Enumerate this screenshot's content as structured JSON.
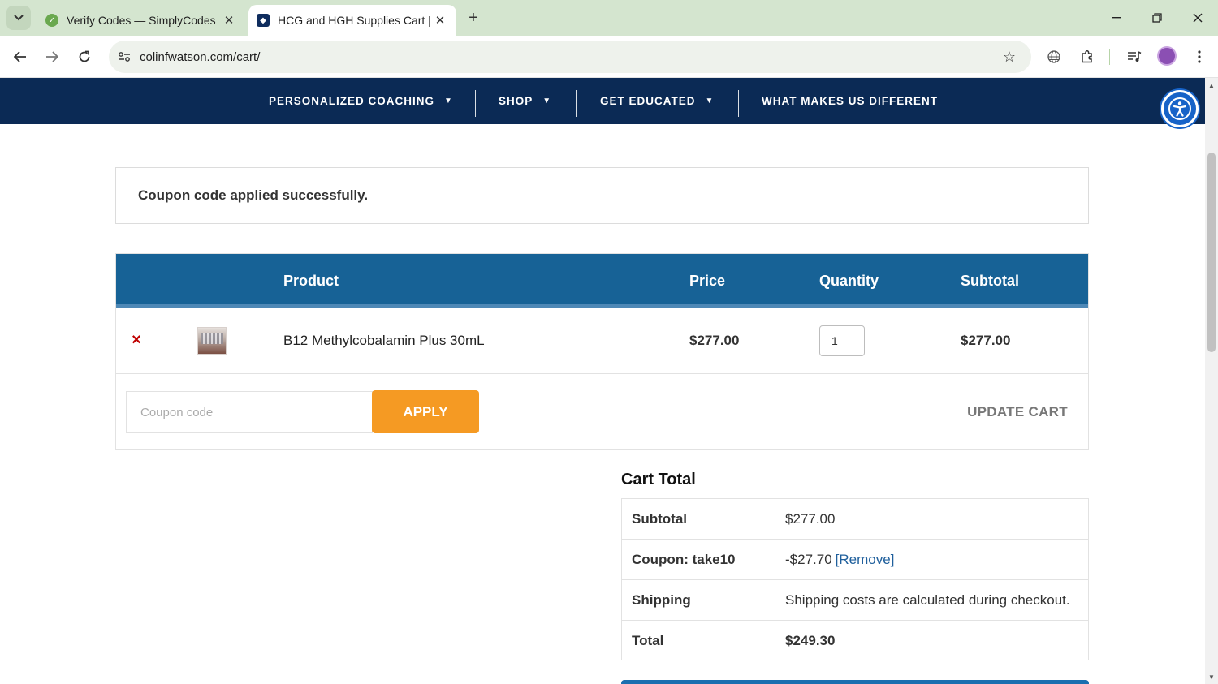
{
  "browser": {
    "tabs": [
      {
        "title": "Verify Codes — SimplyCodes",
        "active": false
      },
      {
        "title": "HCG and HGH Supplies Cart | C",
        "active": true
      }
    ],
    "new_tab_glyph": "+",
    "url": "colinfwatson.com/cart/"
  },
  "nav": {
    "items": [
      {
        "label": "PERSONALIZED COACHING",
        "has_dropdown": true
      },
      {
        "label": "SHOP",
        "has_dropdown": true
      },
      {
        "label": "GET EDUCATED",
        "has_dropdown": true
      },
      {
        "label": "WHAT MAKES US DIFFERENT",
        "has_dropdown": false
      }
    ]
  },
  "notice": {
    "text": "Coupon code applied successfully."
  },
  "cart": {
    "headers": {
      "product": "Product",
      "price": "Price",
      "quantity": "Quantity",
      "subtotal": "Subtotal"
    },
    "items": [
      {
        "remove_glyph": "×",
        "name": "B12 Methylcobalamin Plus 30mL",
        "price": "$277.00",
        "quantity": "1",
        "subtotal": "$277.00"
      }
    ],
    "coupon_placeholder": "Coupon code",
    "apply_label": "APPLY",
    "update_label": "UPDATE CART"
  },
  "totals": {
    "title": "Cart Total",
    "subtotal_label": "Subtotal",
    "subtotal_value": "$277.00",
    "coupon_label": "Coupon: take10",
    "coupon_value": "-$27.70",
    "coupon_remove": "[Remove]",
    "shipping_label": "Shipping",
    "shipping_value": "Shipping costs are calculated during checkout.",
    "total_label": "Total",
    "total_value": "$249.30"
  },
  "colors": {
    "nav_bg": "#0b2a55",
    "table_header_bg": "#176296",
    "apply_button": "#f59a23",
    "remove_x": "#c00000",
    "link": "#1f5f9c",
    "accessibility_button": "#1763c8"
  }
}
